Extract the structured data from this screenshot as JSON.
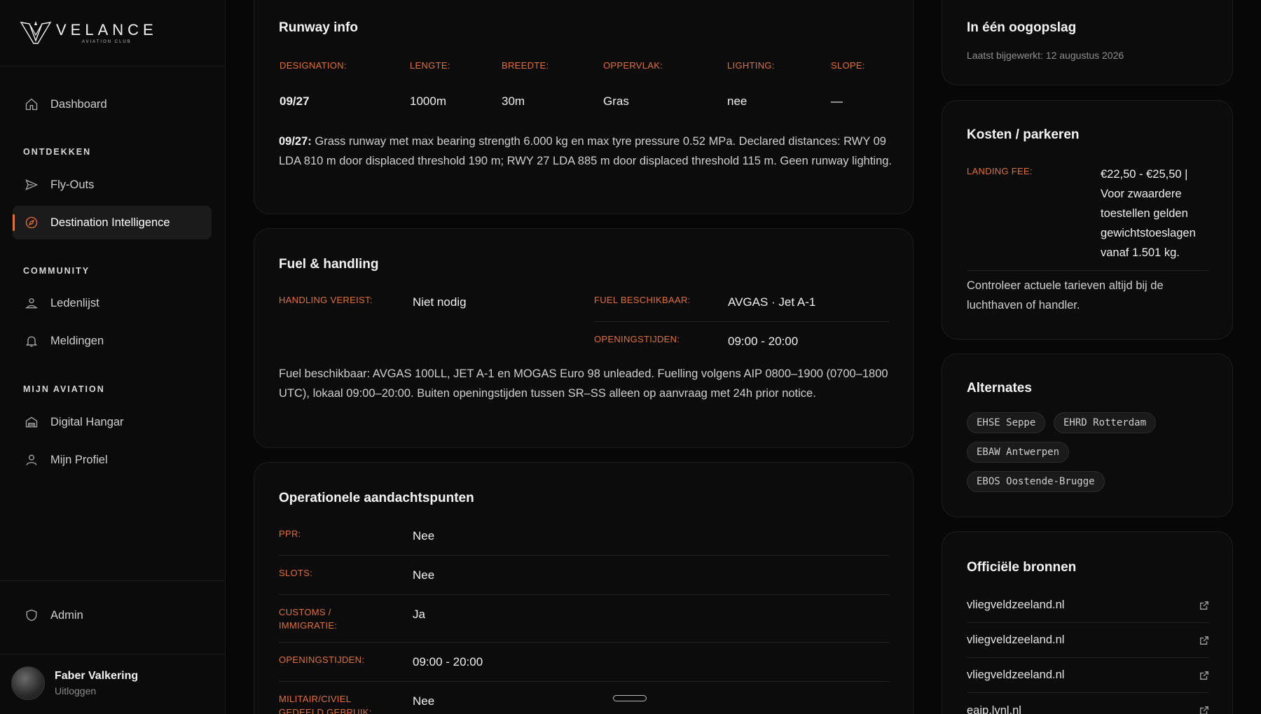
{
  "brand": {
    "name": "VELANCE",
    "sub": "AVIATION CLUB"
  },
  "nav": {
    "dashboard": "Dashboard",
    "section_ontdekken": "ONTDEKKEN",
    "flyouts": "Fly-Outs",
    "destination": "Destination Intelligence",
    "section_community": "COMMUNITY",
    "ledenlijst": "Ledenlijst",
    "meldingen": "Meldingen",
    "section_mijn": "MIJN AVIATION",
    "hangar": "Digital Hangar",
    "profiel": "Mijn Profiel",
    "admin": "Admin"
  },
  "user": {
    "name": "Faber Valkering",
    "logout": "Uitloggen"
  },
  "runway": {
    "title": "Runway info",
    "headers": [
      "DESIGNATION:",
      "LENGTE:",
      "BREEDTE:",
      "OPPERVLAK:",
      "LIGHTING:",
      "SLOPE:"
    ],
    "values": [
      "09/27",
      "1000m",
      "30m",
      "Gras",
      "nee",
      "—"
    ],
    "note_label": "09/27:",
    "note": " Grass runway met max bearing strength 6.000 kg en max tyre pressure 0.52 MPa. Declared distances: RWY 09 LDA 810 m door displaced threshold 190 m; RWY 27 LDA 885 m door displaced threshold 115 m. Geen runway lighting."
  },
  "fuel": {
    "title": "Fuel & handling",
    "handling_label": "HANDLING VEREIST:",
    "handling_value": "Niet nodig",
    "fuel_label": "FUEL BESCHIKBAAR:",
    "fuel_value": "AVGAS · Jet A-1",
    "hours_label": "OPENINGSTIJDEN:",
    "hours_value": "09:00 - 20:00",
    "note": "Fuel beschikbaar: AVGAS 100LL, JET A-1 en MOGAS Euro 98 unleaded. Fuelling volgens AIP 0800–1900 (0700–1800 UTC), lokaal 09:00–20:00. Buiten openingstijden tussen SR–SS alleen op aanvraag met 24h prior notice."
  },
  "ops": {
    "title": "Operationele aandachtspunten",
    "rows": [
      {
        "label": "PPR:",
        "value": "Nee"
      },
      {
        "label": "SLOTS:",
        "value": "Nee"
      },
      {
        "label": "CUSTOMS / IMMIGRATIE:",
        "value": "Ja"
      },
      {
        "label": "OPENINGSTIJDEN:",
        "value": "09:00 - 20:00"
      },
      {
        "label": "MILITAIR/CIVIEL GEDEELD GEBRUIK:",
        "value": "Nee"
      }
    ]
  },
  "glance": {
    "title": "In één oogopslag",
    "updated": "Laatst bijgewerkt: 12 augustus 2026"
  },
  "costs": {
    "title": "Kosten / parkeren",
    "fee_label": "LANDING FEE:",
    "fee_lines": [
      "€22,50 - €25,50 |",
      "Voor zwaardere",
      "toestellen gelden",
      "gewichtstoeslagen",
      "vanaf 1.501 kg."
    ],
    "note": "Controleer actuele tarieven altijd bij de luchthaven of handler."
  },
  "alternates": {
    "title": "Alternates",
    "chips": [
      "EHSE Seppe",
      "EHRD Rotterdam",
      "EBAW Antwerpen",
      "EBOS Oostende-Brugge"
    ]
  },
  "sources": {
    "title": "Officiële bronnen",
    "links": [
      "vliegveldzeeland.nl",
      "vliegveldzeeland.nl",
      "vliegveldzeeland.nl",
      "eaip.lvnl.nl"
    ]
  },
  "colors": {
    "accent": "#e0703a",
    "background": "#070707",
    "card": "#0c0c0c"
  }
}
